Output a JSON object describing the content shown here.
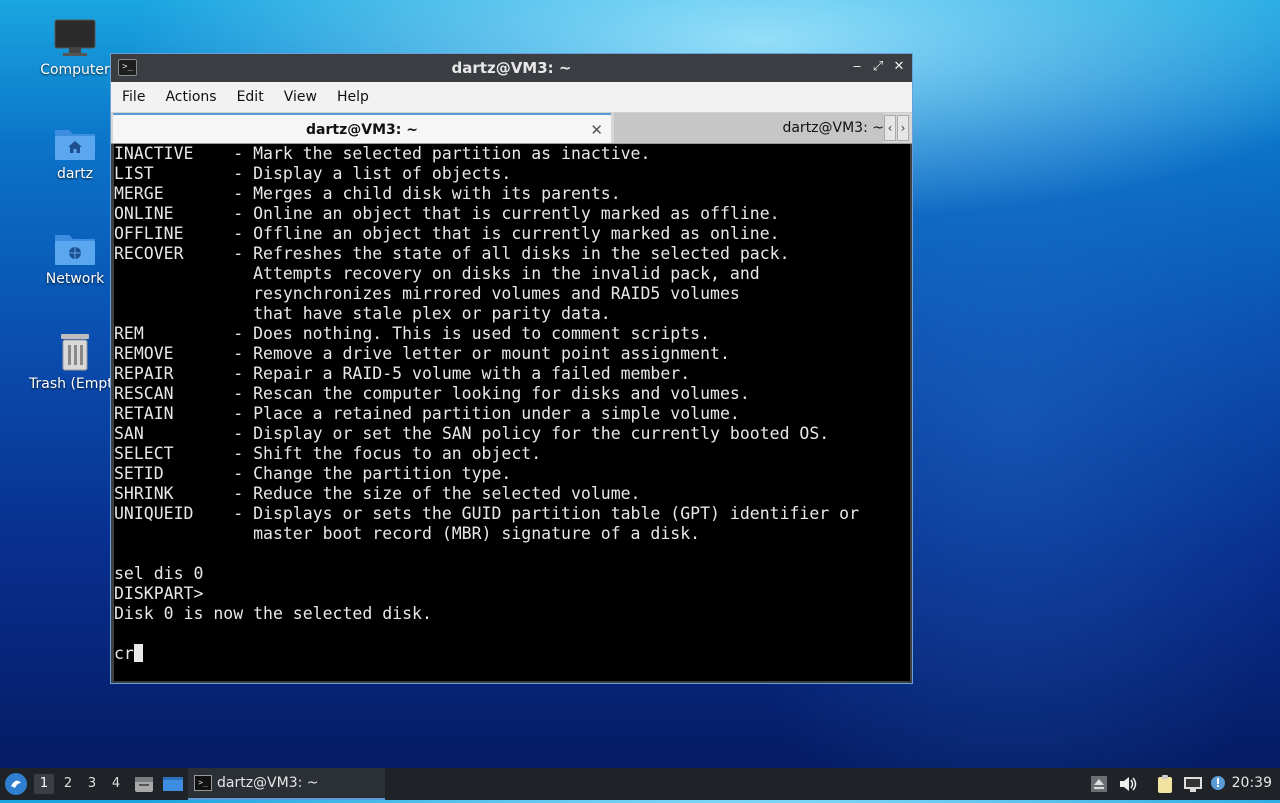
{
  "desktop": {
    "icons": [
      {
        "label": "Computer"
      },
      {
        "label": "dartz"
      },
      {
        "label": "Network"
      },
      {
        "label": "Trash (Empty)"
      }
    ]
  },
  "window": {
    "title": "dartz@VM3: ~",
    "controls": {
      "minimize": "‒",
      "maximize": "⤢",
      "close": "✕"
    },
    "menu": [
      "File",
      "Actions",
      "Edit",
      "View",
      "Help"
    ],
    "tabs": [
      {
        "label": "dartz@VM3: ~",
        "active": true
      },
      {
        "label": "dartz@VM3: ~",
        "active": false
      }
    ],
    "tab_close": "✕",
    "tab_scroll_left": "‹",
    "tab_scroll_right": "›",
    "terminal_lines": [
      "INACTIVE    - Mark the selected partition as inactive.",
      "LIST        - Display a list of objects.",
      "MERGE       - Merges a child disk with its parents.",
      "ONLINE      - Online an object that is currently marked as offline.",
      "OFFLINE     - Offline an object that is currently marked as online.",
      "RECOVER     - Refreshes the state of all disks in the selected pack.",
      "              Attempts recovery on disks in the invalid pack, and",
      "              resynchronizes mirrored volumes and RAID5 volumes",
      "              that have stale plex or parity data.",
      "REM         - Does nothing. This is used to comment scripts.",
      "REMOVE      - Remove a drive letter or mount point assignment.",
      "REPAIR      - Repair a RAID-5 volume with a failed member.",
      "RESCAN      - Rescan the computer looking for disks and volumes.",
      "RETAIN      - Place a retained partition under a simple volume.",
      "SAN         - Display or set the SAN policy for the currently booted OS.",
      "SELECT      - Shift the focus to an object.",
      "SETID       - Change the partition type.",
      "SHRINK      - Reduce the size of the selected volume.",
      "UNIQUEID    - Displays or sets the GUID partition table (GPT) identifier or",
      "              master boot record (MBR) signature of a disk.",
      "",
      "sel dis 0",
      "DISKPART>",
      "Disk 0 is now the selected disk.",
      ""
    ],
    "prompt_input": "cr"
  },
  "taskbar": {
    "workspaces": [
      "1",
      "2",
      "3",
      "4"
    ],
    "active_workspace": "1",
    "task_label": "dartz@VM3: ~",
    "clock": "20:39"
  }
}
